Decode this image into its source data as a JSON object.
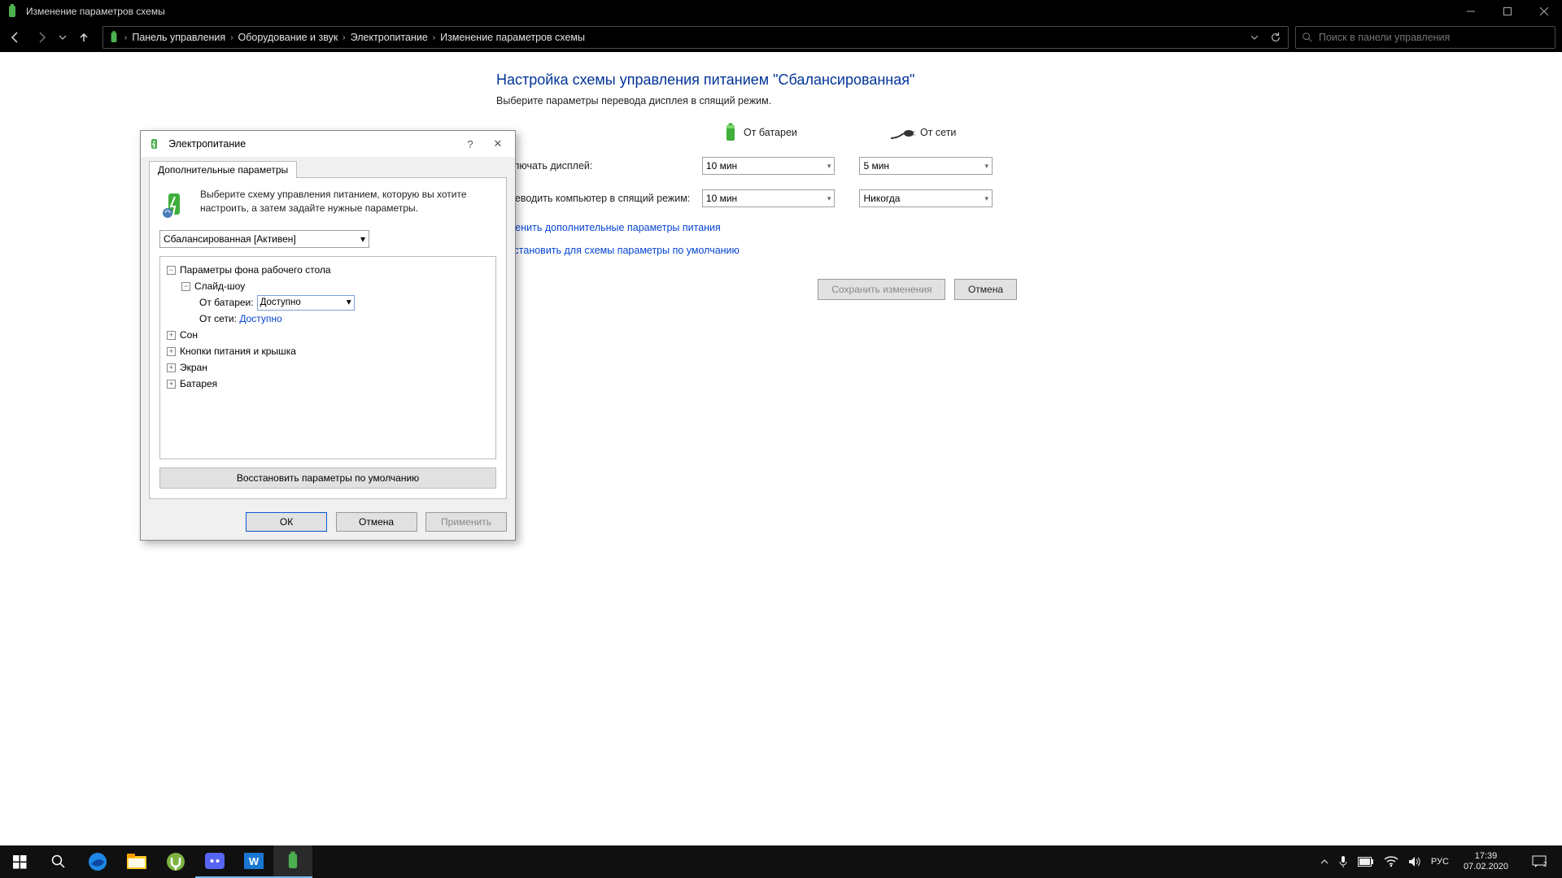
{
  "window": {
    "title": "Изменение параметров схемы"
  },
  "breadcrumb": {
    "items": [
      "Панель управления",
      "Оборудование и звук",
      "Электропитание",
      "Изменение параметров схемы"
    ]
  },
  "search": {
    "placeholder": "Поиск в панели управления"
  },
  "page": {
    "title": "Настройка схемы управления питанием \"Сбалансированная\"",
    "subtitle": "Выберите параметры перевода дисплея в спящий режим.",
    "col_battery": "От батареи",
    "col_plugged": "От сети",
    "row_display": "Отключать дисплей:",
    "row_sleep": "Переводить компьютер в спящий режим:",
    "display_battery": "10 мин",
    "display_plugged": "5 мин",
    "sleep_battery": "10 мин",
    "sleep_plugged": "Никогда",
    "link_advanced": "Изменить дополнительные параметры питания",
    "link_restore": "Восстановить для схемы параметры по умолчанию",
    "btn_save": "Сохранить изменения",
    "btn_cancel": "Отмена"
  },
  "dialog": {
    "title": "Электропитание",
    "tab": "Дополнительные параметры",
    "desc": "Выберите схему управления питанием, которую вы хотите настроить, а затем задайте нужные параметры.",
    "plan_selected": "Сбалансированная [Активен]",
    "tree": {
      "desktop_bg": "Параметры фона рабочего стола",
      "slideshow": "Слайд-шоу",
      "on_battery_label": "От батареи:",
      "on_battery_value": "Доступно",
      "on_ac_label": "От сети:",
      "on_ac_value": "Доступно",
      "sleep": "Сон",
      "buttons_lid": "Кнопки питания и крышка",
      "display": "Экран",
      "battery": "Батарея"
    },
    "restore_defaults": "Восстановить параметры по умолчанию",
    "btn_ok": "ОК",
    "btn_cancel": "Отмена",
    "btn_apply": "Применить"
  },
  "tray": {
    "lang": "РУС",
    "time": "17:39",
    "date": "07.02.2020"
  }
}
